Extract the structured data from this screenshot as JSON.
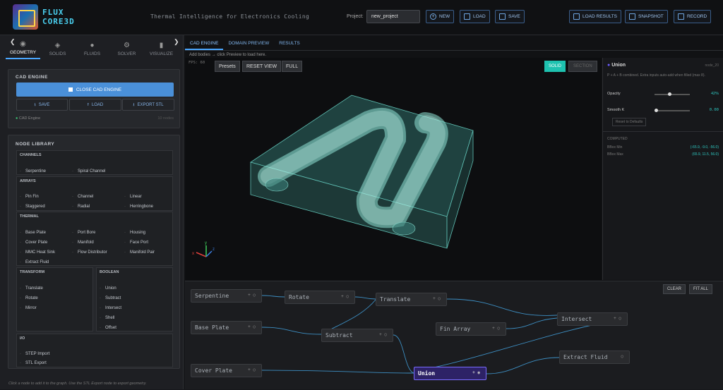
{
  "header": {
    "brand_line1": "FLUX",
    "brand_line2": "CORE3D",
    "tagline": "Thermal Intelligence for Electronics Cooling",
    "project_label": "Project:",
    "project_value": "new_project",
    "buttons": {
      "new": "NEW",
      "load": "LOAD",
      "save": "SAVE",
      "load_results": "LOAD RESULTS",
      "snapshot": "SNAPSHOT",
      "record": "RECORD"
    }
  },
  "left_tabs": [
    {
      "label": "GEOMETRY",
      "icon": "geometry-icon",
      "active": true
    },
    {
      "label": "SOLIDS",
      "icon": "layers-icon"
    },
    {
      "label": "FLUIDS",
      "icon": "droplet-icon"
    },
    {
      "label": "SOLVER",
      "icon": "gear-icon"
    },
    {
      "label": "VISUALIZE",
      "icon": "bar-chart-icon"
    }
  ],
  "cad_panel": {
    "title": "CAD ENGINE",
    "close_btn": "CLOSE CAD ENGINE",
    "save": "SAVE",
    "load": "LOAD",
    "export": "EXPORT STL",
    "status": "CAD Engine",
    "node_count": "10 nodes"
  },
  "library": {
    "title": "NODE LIBRARY",
    "channels": {
      "title": "CHANNELS",
      "items": [
        "Serpentine",
        "Spiral Channel"
      ]
    },
    "arrays": {
      "title": "ARRAYS",
      "items": [
        "Pin Fin",
        "Channel",
        "Linear",
        "Staggered",
        "Radial",
        "Herringbone"
      ]
    },
    "thermal": {
      "title": "THERMAL",
      "items": [
        "Base Plate",
        "Port Bore",
        "Housing",
        "Cover Plate",
        "Manifold",
        "Face Port",
        "MMC Heat Sink",
        "Flow Distributor",
        "Manifold Pair",
        "Extract Fluid"
      ]
    },
    "transform": {
      "title": "TRANSFORM",
      "items": [
        "Translate",
        "Rotate",
        "Mirror"
      ]
    },
    "boolean": {
      "title": "BOOLEAN",
      "items": [
        "Union",
        "Subtract",
        "Intersect",
        "Shell",
        "Offset"
      ]
    },
    "io": {
      "title": "I/O",
      "items": [
        "STEP Import",
        "STL Export"
      ]
    },
    "hint": "Click a node to add it to the graph. Use the STL Export node to export geometry."
  },
  "center_tabs": [
    "CAD ENGINE",
    "DOMAIN PREVIEW",
    "RESULTS"
  ],
  "subtitle": "Add bodies → click Preview to load here.",
  "viewport": {
    "fps": "FPS: 60",
    "presets": "Presets",
    "reset": "RESET VIEW",
    "full": "FULL",
    "solid": "SOLID",
    "section": "SECTION",
    "axes": {
      "x": "x",
      "y": "y",
      "z": "z"
    }
  },
  "props": {
    "title": "Union",
    "node_id": "node_20",
    "desc": "P + A + B combined. Extra inputs auto-add when filled (max 8).",
    "opacity_label": "Opacity",
    "opacity_value": "42%",
    "opacity_level": 0.42,
    "smooth_label": "Smooth K",
    "smooth_value": "0.00",
    "reset": "Reset to Defaults",
    "computed": "COMPUTED",
    "bbox_min_label": "BBox Min",
    "bbox_min": "(-65.9, -9.0, -56.0)",
    "bbox_max_label": "BBox Max",
    "bbox_max": "(65.9, 11.5, 56.0)"
  },
  "graph": {
    "clear": "CLEAR",
    "fit": "FIT ALL",
    "nodes": [
      "Serpentine",
      "Rotate",
      "Translate",
      "Base Plate",
      "Subtract",
      "Fin Array",
      "Intersect",
      "Cover Plate",
      "Union",
      "Extract Fluid"
    ]
  },
  "colors": {
    "accent": "#4a90d9",
    "teal": "#2ec7c0",
    "selected": "#7a6cff"
  }
}
